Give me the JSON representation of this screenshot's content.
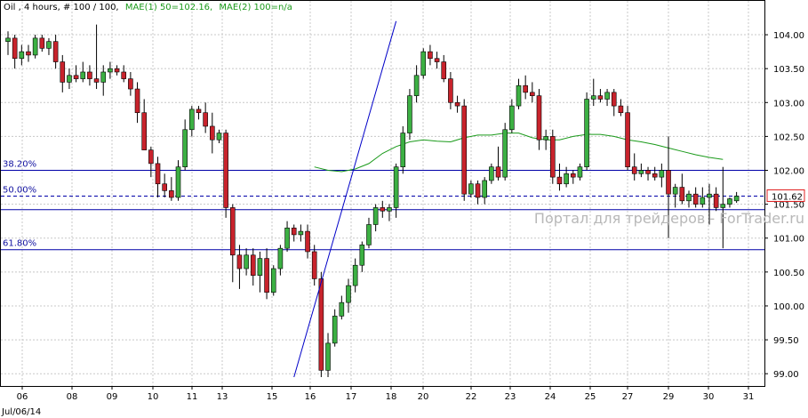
{
  "header": {
    "symbol_info": "Oil , 4 hours, # 100 / 100,",
    "indicator_1": "MAE(1) 50=102.16,",
    "indicator_2": "MAE(2) 100=n/a"
  },
  "watermark": "Портал для трейдеров - ForTrader.ru",
  "colors": {
    "bull": "#3cb043",
    "bear": "#c8232c",
    "wick": "#000000",
    "ma": "#1a9a1a",
    "fib": "#0000a8",
    "trendline": "#0000c8",
    "grid": "#c8c8c8",
    "indicator": "#1a9a1a",
    "current_price_border": "#e02020"
  },
  "chart_data": {
    "type": "candlestick",
    "timeframe": "4 hours",
    "symbol": "Oil",
    "ylim": [
      98.95,
      104.25
    ],
    "y_ticks": [
      "104.00",
      "103.50",
      "103.00",
      "102.50",
      "102.00",
      "101.50",
      "101.00",
      "100.50",
      "100.00",
      "99.50",
      "99.00"
    ],
    "x_ticks": [
      "06",
      "08",
      "09",
      "10",
      "11",
      "13",
      "15",
      "16",
      "17",
      "18",
      "20",
      "22",
      "23",
      "24",
      "25",
      "27",
      "29",
      "30",
      "31"
    ],
    "x_sub_label": "Jul/06/14",
    "current_price": "101.62",
    "fib_levels": [
      {
        "label": "38.20%",
        "value": 102.0,
        "style": "solid"
      },
      {
        "label": "50.00%",
        "value": 101.62,
        "style": "dashed"
      },
      {
        "label": "",
        "value": 101.42,
        "style": "solid"
      },
      {
        "label": "61.80%",
        "value": 100.83,
        "style": "solid"
      }
    ],
    "trendline": {
      "from": [
        42,
        98.95
      ],
      "to": [
        57,
        104.2
      ]
    },
    "candles": [
      [
        103.9,
        104.05,
        103.7,
        103.95
      ],
      [
        103.95,
        104.0,
        103.5,
        103.65
      ],
      [
        103.65,
        103.85,
        103.55,
        103.75
      ],
      [
        103.75,
        103.85,
        103.6,
        103.7
      ],
      [
        103.7,
        104.0,
        103.65,
        103.95
      ],
      [
        103.95,
        104.0,
        103.75,
        103.8
      ],
      [
        103.8,
        103.95,
        103.7,
        103.9
      ],
      [
        103.9,
        104.0,
        103.5,
        103.6
      ],
      [
        103.6,
        103.7,
        103.15,
        103.3
      ],
      [
        103.3,
        103.5,
        103.2,
        103.4
      ],
      [
        103.4,
        103.55,
        103.3,
        103.35
      ],
      [
        103.35,
        103.6,
        103.3,
        103.45
      ],
      [
        103.45,
        103.55,
        103.25,
        103.35
      ],
      [
        103.35,
        104.15,
        103.2,
        103.3
      ],
      [
        103.3,
        103.55,
        103.1,
        103.45
      ],
      [
        103.45,
        103.6,
        103.35,
        103.5
      ],
      [
        103.5,
        103.55,
        103.4,
        103.45
      ],
      [
        103.45,
        103.55,
        103.3,
        103.35
      ],
      [
        103.35,
        103.45,
        103.1,
        103.2
      ],
      [
        103.2,
        103.3,
        102.7,
        102.85
      ],
      [
        102.85,
        103.05,
        102.3,
        102.3
      ],
      [
        102.3,
        102.35,
        101.9,
        102.1
      ],
      [
        102.1,
        102.2,
        101.6,
        101.8
      ],
      [
        101.8,
        101.95,
        101.6,
        101.7
      ],
      [
        101.7,
        101.9,
        101.55,
        101.6
      ],
      [
        101.6,
        102.15,
        101.55,
        102.05
      ],
      [
        102.05,
        102.75,
        102.0,
        102.6
      ],
      [
        102.6,
        102.95,
        102.5,
        102.9
      ],
      [
        102.9,
        102.95,
        102.75,
        102.85
      ],
      [
        102.85,
        103.0,
        102.55,
        102.65
      ],
      [
        102.65,
        102.85,
        102.25,
        102.45
      ],
      [
        102.45,
        102.6,
        102.4,
        102.55
      ],
      [
        102.55,
        102.6,
        101.3,
        101.45
      ],
      [
        101.45,
        101.5,
        100.35,
        100.75
      ],
      [
        100.75,
        100.9,
        100.25,
        100.55
      ],
      [
        100.55,
        100.85,
        100.45,
        100.75
      ],
      [
        100.75,
        100.85,
        100.3,
        100.45
      ],
      [
        100.45,
        100.8,
        100.2,
        100.7
      ],
      [
        100.7,
        100.85,
        100.1,
        100.2
      ],
      [
        100.2,
        100.6,
        100.15,
        100.55
      ],
      [
        100.55,
        100.9,
        100.45,
        100.85
      ],
      [
        100.85,
        101.25,
        100.8,
        101.15
      ],
      [
        101.15,
        101.2,
        100.95,
        101.05
      ],
      [
        101.05,
        101.2,
        100.95,
        101.1
      ],
      [
        101.1,
        101.2,
        100.7,
        100.8
      ],
      [
        100.8,
        100.9,
        100.3,
        100.4
      ],
      [
        100.4,
        100.5,
        98.95,
        99.05
      ],
      [
        99.05,
        99.6,
        98.95,
        99.45
      ],
      [
        99.45,
        99.95,
        99.4,
        99.85
      ],
      [
        99.85,
        100.15,
        99.8,
        100.05
      ],
      [
        100.05,
        100.4,
        99.9,
        100.3
      ],
      [
        100.3,
        100.7,
        100.2,
        100.6
      ],
      [
        100.6,
        100.95,
        100.5,
        100.9
      ],
      [
        100.9,
        101.3,
        100.85,
        101.2
      ],
      [
        101.2,
        101.5,
        101.1,
        101.45
      ],
      [
        101.45,
        101.55,
        101.3,
        101.4
      ],
      [
        101.4,
        101.5,
        101.25,
        101.45
      ],
      [
        101.45,
        102.1,
        101.3,
        102.05
      ],
      [
        102.05,
        102.65,
        101.95,
        102.55
      ],
      [
        102.55,
        103.2,
        102.45,
        103.1
      ],
      [
        103.1,
        103.55,
        103.0,
        103.4
      ],
      [
        103.4,
        103.8,
        103.35,
        103.75
      ],
      [
        103.75,
        103.85,
        103.55,
        103.65
      ],
      [
        103.65,
        103.75,
        103.5,
        103.6
      ],
      [
        103.6,
        103.7,
        103.3,
        103.35
      ],
      [
        103.35,
        103.45,
        102.9,
        103.0
      ],
      [
        103.0,
        103.1,
        102.85,
        102.95
      ],
      [
        102.95,
        103.05,
        101.55,
        101.65
      ],
      [
        101.65,
        101.85,
        101.6,
        101.8
      ],
      [
        101.8,
        101.85,
        101.5,
        101.6
      ],
      [
        101.6,
        101.9,
        101.5,
        101.85
      ],
      [
        101.85,
        102.1,
        101.8,
        102.05
      ],
      [
        102.05,
        102.35,
        101.85,
        101.9
      ],
      [
        101.9,
        102.7,
        101.85,
        102.6
      ],
      [
        102.6,
        103.05,
        102.55,
        102.95
      ],
      [
        102.95,
        103.35,
        102.9,
        103.25
      ],
      [
        103.25,
        103.4,
        103.05,
        103.15
      ],
      [
        103.15,
        103.3,
        103.0,
        103.1
      ],
      [
        103.1,
        103.2,
        102.3,
        102.45
      ],
      [
        102.45,
        102.6,
        102.3,
        102.5
      ],
      [
        102.5,
        102.6,
        101.8,
        101.9
      ],
      [
        101.9,
        102.1,
        101.7,
        101.8
      ],
      [
        101.8,
        102.05,
        101.75,
        101.95
      ],
      [
        101.95,
        102.0,
        101.8,
        101.9
      ],
      [
        101.9,
        102.1,
        101.85,
        102.05
      ],
      [
        102.05,
        103.15,
        102.0,
        103.05
      ],
      [
        103.05,
        103.35,
        102.95,
        103.1
      ],
      [
        103.1,
        103.2,
        103.0,
        103.05
      ],
      [
        103.05,
        103.2,
        102.95,
        103.15
      ],
      [
        103.15,
        103.2,
        102.8,
        102.95
      ],
      [
        102.95,
        103.05,
        102.8,
        102.85
      ],
      [
        102.85,
        102.95,
        102.0,
        102.05
      ],
      [
        102.05,
        102.25,
        101.85,
        101.95
      ],
      [
        101.95,
        102.1,
        101.9,
        102.0
      ],
      [
        102.0,
        102.05,
        101.85,
        101.95
      ],
      [
        101.95,
        102.05,
        101.85,
        101.9
      ],
      [
        101.9,
        102.1,
        101.75,
        102.0
      ],
      [
        102.0,
        102.5,
        101.0,
        101.65
      ],
      [
        101.65,
        101.8,
        101.45,
        101.75
      ],
      [
        101.75,
        101.95,
        101.5,
        101.55
      ],
      [
        101.55,
        101.7,
        101.45,
        101.65
      ],
      [
        101.65,
        101.75,
        101.45,
        101.5
      ],
      [
        101.5,
        101.75,
        101.45,
        101.6
      ],
      [
        101.6,
        101.8,
        101.2,
        101.65
      ],
      [
        101.65,
        101.75,
        101.4,
        101.45
      ],
      [
        101.45,
        102.05,
        100.85,
        101.5
      ],
      [
        101.5,
        101.6,
        101.45,
        101.58
      ],
      [
        101.55,
        101.68,
        101.52,
        101.62
      ]
    ],
    "ma_50": [
      [
        45,
        102.05
      ],
      [
        47,
        102.0
      ],
      [
        49,
        101.98
      ],
      [
        51,
        102.02
      ],
      [
        53,
        102.1
      ],
      [
        55,
        102.25
      ],
      [
        57,
        102.35
      ],
      [
        59,
        102.42
      ],
      [
        61,
        102.45
      ],
      [
        63,
        102.43
      ],
      [
        65,
        102.42
      ],
      [
        67,
        102.48
      ],
      [
        69,
        102.52
      ],
      [
        71,
        102.52
      ],
      [
        73,
        102.55
      ],
      [
        75,
        102.55
      ],
      [
        77,
        102.48
      ],
      [
        79,
        102.45
      ],
      [
        81,
        102.45
      ],
      [
        83,
        102.5
      ],
      [
        85,
        102.53
      ],
      [
        87,
        102.53
      ],
      [
        89,
        102.5
      ],
      [
        91,
        102.45
      ],
      [
        93,
        102.42
      ],
      [
        95,
        102.38
      ],
      [
        97,
        102.33
      ],
      [
        99,
        102.28
      ],
      [
        101,
        102.23
      ],
      [
        103,
        102.19
      ],
      [
        105,
        102.16
      ]
    ]
  }
}
